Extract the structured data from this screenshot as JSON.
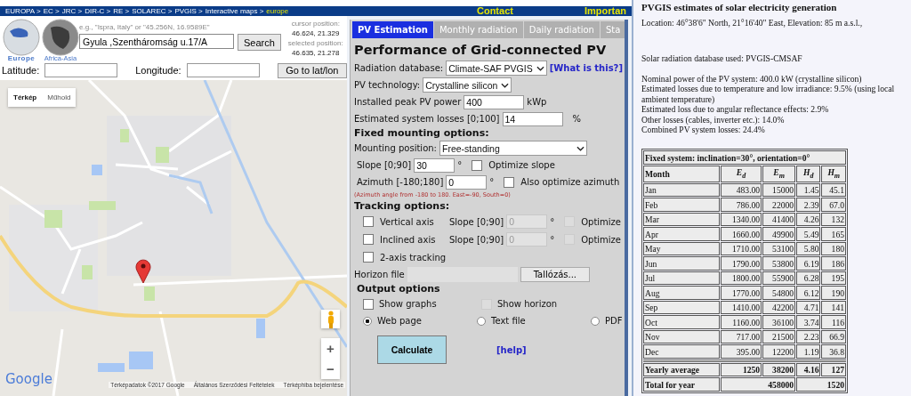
{
  "breadcrumb": [
    {
      "label": "EUROPA >",
      "current": false
    },
    {
      "label": "EC >",
      "current": false
    },
    {
      "label": "JRC >",
      "current": false
    },
    {
      "label": "DIR-C >",
      "current": false
    },
    {
      "label": "RE >",
      "current": false
    },
    {
      "label": "SOLAREC >",
      "current": false
    },
    {
      "label": "PVGIS >",
      "current": false
    },
    {
      "label": "Interactive maps >",
      "current": false
    },
    {
      "label": "europe",
      "current": true
    }
  ],
  "nav_links": [
    "Contact",
    "Importan"
  ],
  "regions": [
    {
      "label": "Europe",
      "selected": true
    },
    {
      "label": "Africa-Asia",
      "selected": false
    }
  ],
  "search": {
    "hint": "e.g., \"Ispra, Italy\" or \"45.256N, 16.9589E\"",
    "value": "Gyula ,Szentháromság u.17/A",
    "button": "Search"
  },
  "positions": {
    "cursor_label": "cursor position:",
    "cursor": "46.624, 21.329",
    "selected_label": "selected position:",
    "selected": "46.635, 21.278"
  },
  "coords": {
    "latitude_label": "Latitude:",
    "longitude_label": "Longitude:",
    "button": "Go to lat/lon"
  },
  "map": {
    "types": [
      {
        "label": "Térkép",
        "selected": true
      },
      {
        "label": "Műhold",
        "selected": false
      }
    ],
    "zoom_in": "+",
    "zoom_out": "−",
    "logo": "Google",
    "attribution": [
      "Térképadatok ©2017 Google",
      "Általános Szerződési Feltételek",
      "Térképhiba bejelentése"
    ]
  },
  "tabs": [
    {
      "label": "PV Estimation",
      "selected": true
    },
    {
      "label": "Monthly radiation",
      "selected": false
    },
    {
      "label": "Daily radiation",
      "selected": false
    },
    {
      "label": "Sta",
      "selected": false
    }
  ],
  "form": {
    "title": "Performance of Grid-connected PV",
    "radiation_db": {
      "label": "Radiation database:",
      "value": "Climate-SAF PVGIS",
      "help": "[What is this?]"
    },
    "technology": {
      "label": "PV technology:",
      "value": "Crystalline silicon"
    },
    "peak_power": {
      "label": "Installed peak PV power",
      "value": "400",
      "unit": "kWp"
    },
    "losses": {
      "label": "Estimated system losses [0;100]",
      "value": "14",
      "unit": "%"
    },
    "fixed_heading": "Fixed mounting options:",
    "mounting": {
      "label": "Mounting position:",
      "value": "Free-standing"
    },
    "angles": [
      {
        "label": "Slope [0;90]",
        "value": "30",
        "unit": "°",
        "option": "Optimize slope",
        "checked": false
      },
      {
        "label": "Azimuth [-180;180]",
        "value": "0",
        "unit": "°",
        "option": "Also optimize azimuth",
        "checked": false
      }
    ],
    "azimuth_note": "(Azimuth angle from -180 to 180. East=-90, South=0)",
    "tracking_heading": "Tracking options:",
    "tracking": [
      {
        "kind": "axis",
        "label": "Vertical axis",
        "checked": false,
        "slope_label": "Slope [0;90]",
        "slope_value": "0",
        "unit": "°",
        "optimize": "Optimize",
        "optimize_checked": false,
        "disabled": true
      },
      {
        "kind": "axis",
        "label": "Inclined axis",
        "checked": false,
        "slope_label": "Slope [0;90]",
        "slope_value": "0",
        "unit": "°",
        "optimize": "Optimize",
        "optimize_checked": false,
        "disabled": true
      },
      {
        "kind": "simple",
        "label": "2-axis tracking",
        "checked": false
      }
    ],
    "horizon": {
      "label": "Horizon file",
      "button": "Tallózás..."
    },
    "output_heading": "Output options",
    "output_checks": [
      {
        "label": "Show graphs",
        "checked": false,
        "disabled": false
      },
      {
        "label": "Show horizon",
        "checked": false,
        "disabled": true
      }
    ],
    "output_formats": [
      {
        "label": "Web page",
        "selected": true
      },
      {
        "label": "Text file",
        "selected": false
      },
      {
        "label": "PDF",
        "selected": false
      }
    ],
    "calculate": "Calculate",
    "help": "[help]"
  },
  "results": {
    "title": "PVGIS estimates of solar electricity generation",
    "location": "Location: 46°38'6\" North, 21°16'40\" East, Elevation: 85 m a.s.l.,",
    "database": "Solar radiation database used: PVGIS-CMSAF",
    "lines": [
      "Nominal power of the PV system: 400.0 kW (crystalline silicon)",
      "Estimated losses due to temperature and low irradiance: 9.5% (using local ambient temperature)",
      "Estimated loss due to angular reflectance effects: 2.9%",
      "Other losses (cables, inverter etc.): 14.0%",
      "Combined PV system losses: 24.4%"
    ],
    "table": {
      "caption": "Fixed system: inclination=30°, orientation=0°",
      "columns": [
        "Month",
        "E$_{d}$",
        "E$_{m}$",
        "H$_{d}$",
        "H$_{m}$"
      ],
      "rows": [
        [
          "Jan",
          "483.00",
          "15000",
          "1.45",
          "45.1"
        ],
        [
          "Feb",
          "786.00",
          "22000",
          "2.39",
          "67.0"
        ],
        [
          "Mar",
          "1340.00",
          "41400",
          "4.26",
          "132"
        ],
        [
          "Apr",
          "1660.00",
          "49900",
          "5.49",
          "165"
        ],
        [
          "May",
          "1710.00",
          "53100",
          "5.80",
          "180"
        ],
        [
          "Jun",
          "1790.00",
          "53800",
          "6.19",
          "186"
        ],
        [
          "Jul",
          "1800.00",
          "55900",
          "6.28",
          "195"
        ],
        [
          "Aug",
          "1770.00",
          "54800",
          "6.12",
          "190"
        ],
        [
          "Sep",
          "1410.00",
          "42200",
          "4.71",
          "141"
        ],
        [
          "Oct",
          "1160.00",
          "36100",
          "3.74",
          "116"
        ],
        [
          "Nov",
          "717.00",
          "21500",
          "2.23",
          "66.9"
        ],
        [
          "Dec",
          "395.00",
          "12200",
          "1.19",
          "36.8"
        ]
      ],
      "average": [
        "Yearly average",
        "1250",
        "38200",
        "4.16",
        "127"
      ],
      "total": [
        "Total for year",
        "458000",
        "1520"
      ]
    }
  }
}
